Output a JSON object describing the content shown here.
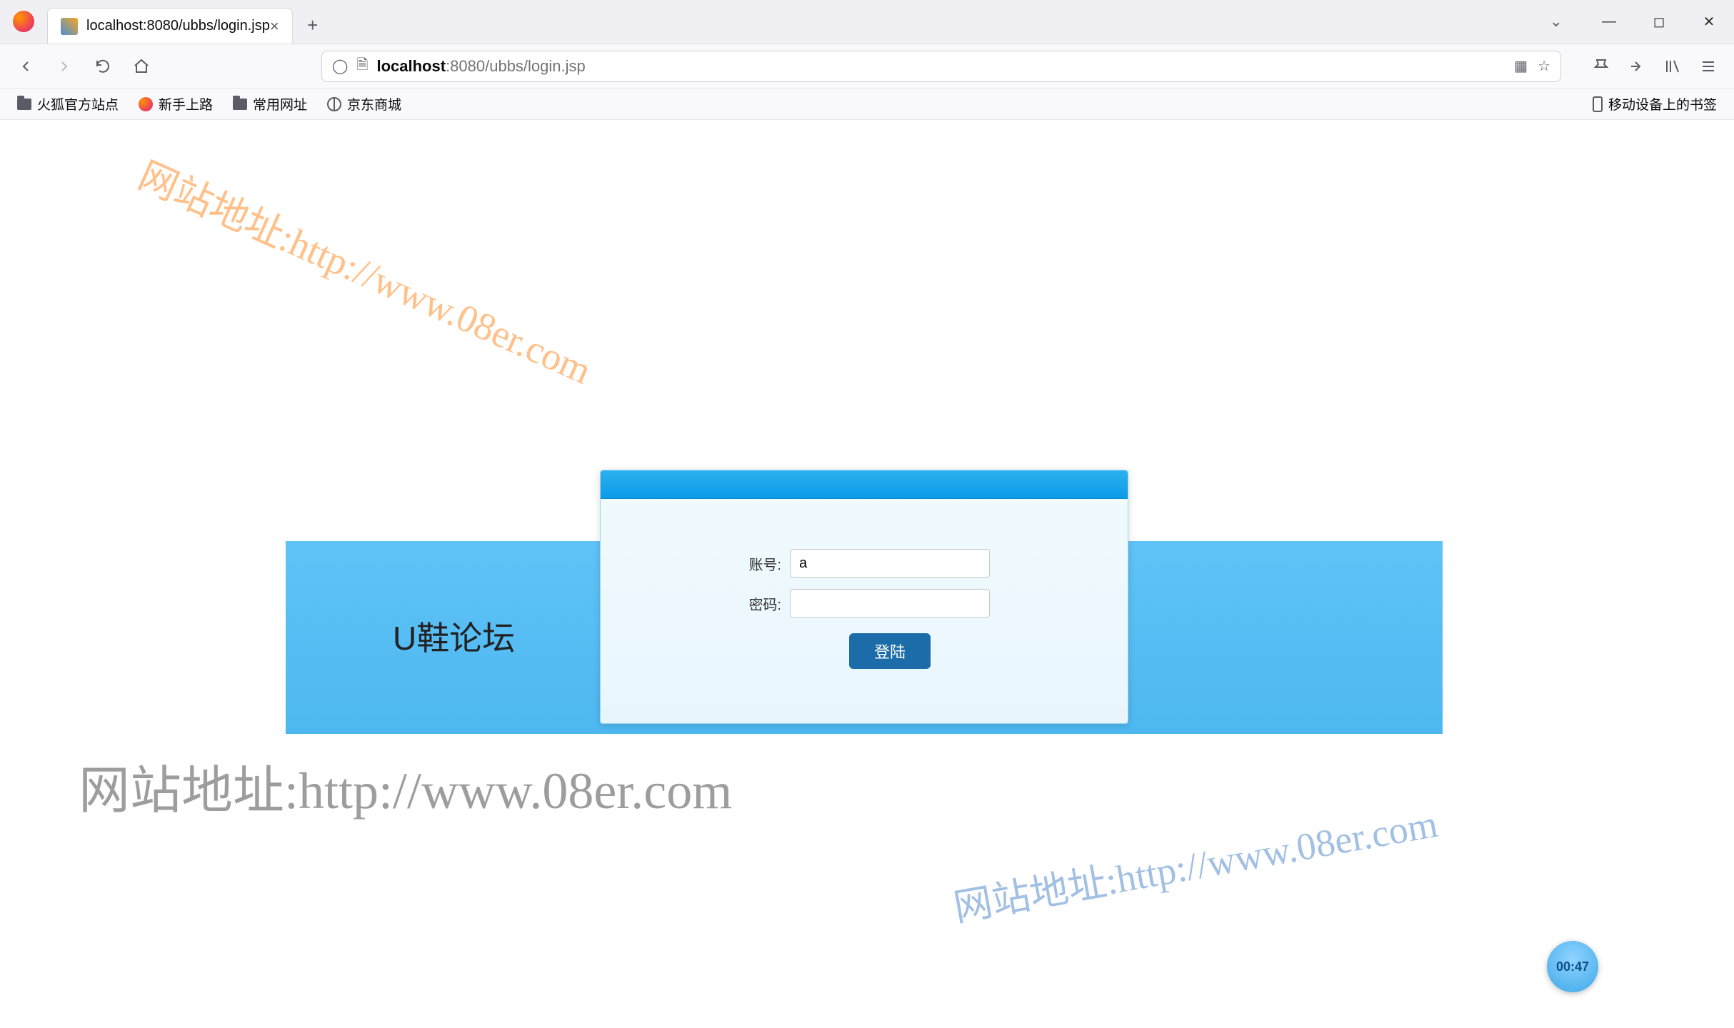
{
  "browser": {
    "tab_title": "localhost:8080/ubbs/login.jsp",
    "url_host": "localhost",
    "url_port_path": ":8080/ubbs/login.jsp"
  },
  "bookmarks": {
    "items": [
      "火狐官方站点",
      "新手上路",
      "常用网址",
      "京东商城"
    ],
    "mobile": "移动设备上的书签"
  },
  "page": {
    "banner_title": "U鞋论坛",
    "form": {
      "username_label": "账号:",
      "username_value": "a",
      "password_label": "密码:",
      "password_value": "",
      "submit_label": "登陆"
    }
  },
  "watermarks": {
    "text": "网站地址:http://www.08er.com"
  },
  "recorder": {
    "time": "00:47"
  }
}
